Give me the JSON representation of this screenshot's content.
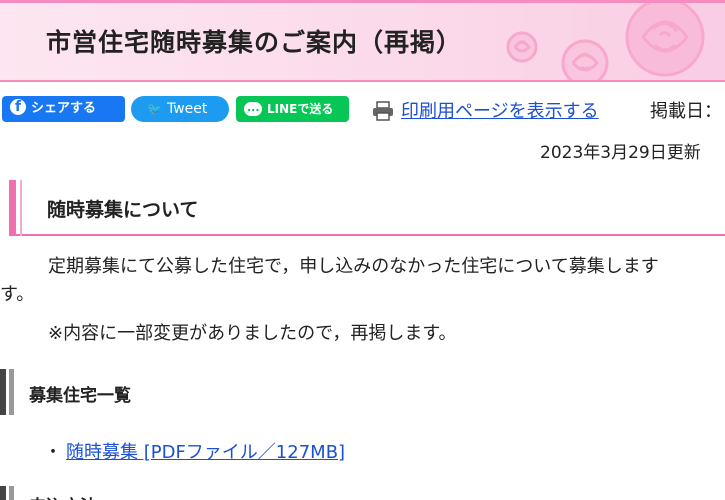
{
  "header": {
    "title": "市営住宅随時募集のご案内（再掲）"
  },
  "share": {
    "facebook_label": "シェアする",
    "twitter_label": "Tweet",
    "line_label": "LINEで送る"
  },
  "print": {
    "link_label": "印刷用ページを表示する"
  },
  "meta": {
    "posted_label": "掲載日：",
    "updated": "2023年3月29日更新"
  },
  "section1": {
    "heading": "随時募集について",
    "para1_line1": "定期募集にて公募した住宅で，申し込みのなかった住宅について募集します",
    "para1_line2": "す。",
    "para2": "※内容に一部変更がありましたので，再掲します。"
  },
  "section2": {
    "heading": "募集住宅一覧",
    "bullet": "・",
    "link_label": "随時募集 [PDFファイル／127MB]"
  },
  "section3": {
    "heading": "申込方法"
  },
  "colors": {
    "accent_pink": "#f06fb1",
    "link_blue": "#1a4fd6",
    "facebook": "#1877f2",
    "twitter": "#1d9bf0",
    "line": "#06c755"
  }
}
